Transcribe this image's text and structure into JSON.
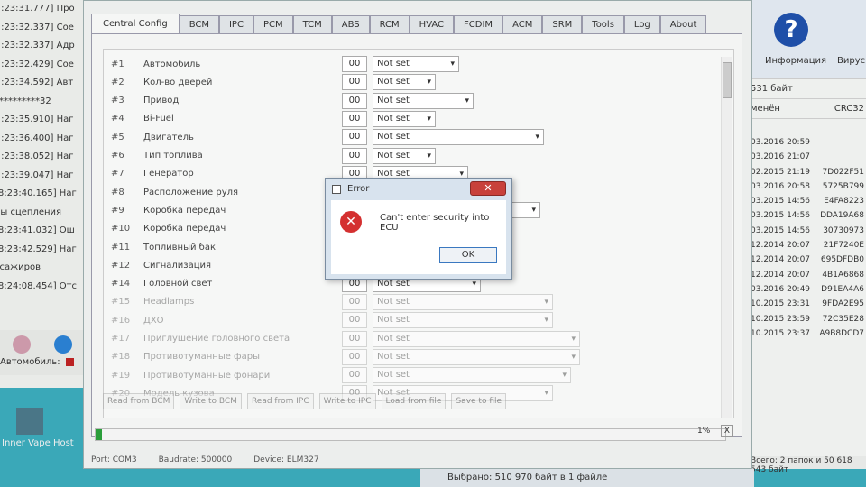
{
  "log": {
    "lines": [
      "[.:23:31.777] Про",
      "[.:23:32.337] Сое",
      "[.:23:32.337] Адр",
      "[.:23:32.429] Сое",
      "[.:23:34.592] Авт",
      "**********32",
      "[.:23:35.910] Наг",
      "[.:23:36.400] Наг",
      "[.:23:38.052] Наг",
      "[.:23:39.047] Наг",
      "[8:23:40.165] Наг",
      "лы сцепления",
      "[8:23:41.032] Ош",
      "[8:23:42.529] Наг",
      "ссажиров",
      "[8:24:08.454] Отс"
    ],
    "auto_label": "Автомобиль:"
  },
  "desktop": {
    "icon_label": "Inner Vape Host"
  },
  "explorer": {
    "info_label": "Информация",
    "virus_label": "Вирусы",
    "size_text": "531 байт",
    "col_modified": "менён",
    "col_crc": "CRC32",
    "rows": [
      [
        "03.2016 20:59",
        ""
      ],
      [
        "03.2016 21:07",
        ""
      ],
      [
        "02.2015 21:19",
        "7D022F51"
      ],
      [
        "03.2016 20:58",
        "5725B799"
      ],
      [
        "03.2015 14:56",
        "E4FA8223"
      ],
      [
        "03.2015 14:56",
        "DDA19A68"
      ],
      [
        "03.2015 14:56",
        "30730973"
      ],
      [
        "12.2014 20:07",
        "21F7240E"
      ],
      [
        "12.2014 20:07",
        "695DFDB0"
      ],
      [
        "12.2014 20:07",
        "4B1A6868"
      ],
      [
        "03.2016 20:49",
        "D91EA4A6"
      ],
      [
        "10.2015 23:31",
        "9FDA2E95"
      ],
      [
        "10.2015 23:59",
        "72C35E28"
      ],
      [
        "10.2015 23:37",
        "A9B8DCD7"
      ]
    ],
    "footer": "Всего: 2 папок и 50 618 543 байт",
    "selected_text": "Выбрано: 510 970 байт в 1 файле"
  },
  "tabs": [
    "Central Config",
    "BCM",
    "IPC",
    "PCM",
    "TCM",
    "ABS",
    "RCM",
    "HVAC",
    "FCDIM",
    "ACM",
    "SRM",
    "Tools",
    "Log",
    "About"
  ],
  "rows": [
    {
      "num": "#1",
      "name": "Автомобиль",
      "val": "00",
      "sel": "Not set"
    },
    {
      "num": "#2",
      "name": "Кол-во дверей",
      "val": "00",
      "sel": "Not set"
    },
    {
      "num": "#3",
      "name": "Привод",
      "val": "00",
      "sel": "Not set"
    },
    {
      "num": "#4",
      "name": "Bi-Fuel",
      "val": "00",
      "sel": "Not set"
    },
    {
      "num": "#5",
      "name": "Двигатель",
      "val": "00",
      "sel": "Not set"
    },
    {
      "num": "#6",
      "name": "Тип топлива",
      "val": "00",
      "sel": "Not set"
    },
    {
      "num": "#7",
      "name": "Генератор",
      "val": "00",
      "sel": "Not set"
    },
    {
      "num": "#8",
      "name": "Расположение руля",
      "val": "00",
      "sel": "Not set"
    },
    {
      "num": "#9",
      "name": "Коробка передач",
      "val": "00",
      "sel": "Not set"
    },
    {
      "num": "#10",
      "name": "Коробка передач",
      "val": "00",
      "sel": "Not set"
    },
    {
      "num": "#11",
      "name": "Топливный бак",
      "val": "00",
      "sel": "Not set"
    },
    {
      "num": "#12",
      "name": "Сигнализация",
      "val": "00",
      "sel": "Not set"
    },
    {
      "num": "#14",
      "name": "Головной свет",
      "val": "00",
      "sel": "Not set"
    },
    {
      "num": "#15",
      "name": "Headlamps",
      "val": "00",
      "sel": "Not set"
    },
    {
      "num": "#16",
      "name": "ДХО",
      "val": "00",
      "sel": "Not set"
    },
    {
      "num": "#17",
      "name": "Приглушение головного света",
      "val": "00",
      "sel": "Not set"
    },
    {
      "num": "#18",
      "name": "Противотуманные фары",
      "val": "00",
      "sel": "Not set"
    },
    {
      "num": "#19",
      "name": "Противотуманные фонари",
      "val": "00",
      "sel": "Not set"
    },
    {
      "num": "#20",
      "name": "Модель кузова",
      "val": "00",
      "sel": "Not set"
    }
  ],
  "buttons": [
    "Read from BCM",
    "Write to BCM",
    "Read from IPC",
    "Write to IPC",
    "Load from file",
    "Save to file"
  ],
  "progress": {
    "percent": 1,
    "label": "1%",
    "cancel": "X"
  },
  "status": {
    "port": "Port: COM3",
    "baud": "Baudrate: 500000",
    "device": "Device: ELM327"
  },
  "dialog": {
    "title": "Error",
    "message": "Can't enter security into ECU",
    "ok": "OK",
    "close": "✕"
  },
  "colors": {
    "progress": "#2a9d3a",
    "error": "#d43030",
    "close": "#c8413b"
  }
}
